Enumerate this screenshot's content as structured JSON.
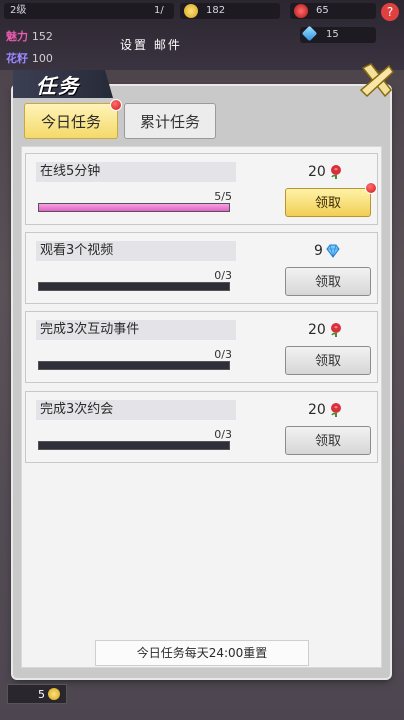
{
  "hud": {
    "level_label": "2级",
    "level_progress": "1/",
    "gold": "182",
    "roses": "65",
    "diamonds": "15",
    "charm_label": "魅力",
    "charm_value": "152",
    "flower_label": "花籽",
    "flower_value": "100",
    "bg_tabs": "设置 邮件",
    "badge_value": "5"
  },
  "window": {
    "title": "任务",
    "close_icon": "close-x-icon"
  },
  "tabs": [
    {
      "label": "今日任务",
      "active": true
    },
    {
      "label": "累计任务",
      "active": false
    }
  ],
  "tasks": [
    {
      "title": "在线5分钟",
      "progress_text": "5/5",
      "progress": 1.0,
      "reward": "20",
      "reward_icon": "rose-icon",
      "claim_label": "领取",
      "claimable": true
    },
    {
      "title": "观看3个视频",
      "progress_text": "0/3",
      "progress": 0.0,
      "reward": "9",
      "reward_icon": "diamond-icon",
      "claim_label": "领取",
      "claimable": false
    },
    {
      "title": "完成3次互动事件",
      "progress_text": "0/3",
      "progress": 0.0,
      "reward": "20",
      "reward_icon": "rose-icon",
      "claim_label": "领取",
      "claimable": false
    },
    {
      "title": "完成3次约会",
      "progress_text": "0/3",
      "progress": 0.0,
      "reward": "20",
      "reward_icon": "rose-icon",
      "claim_label": "领取",
      "claimable": false
    }
  ],
  "footer_note": "今日任务每天24:00重置",
  "colors": {
    "accent_pink": "#e163c7",
    "gold_button": "#f1cf55",
    "notice_red": "#d01818"
  }
}
